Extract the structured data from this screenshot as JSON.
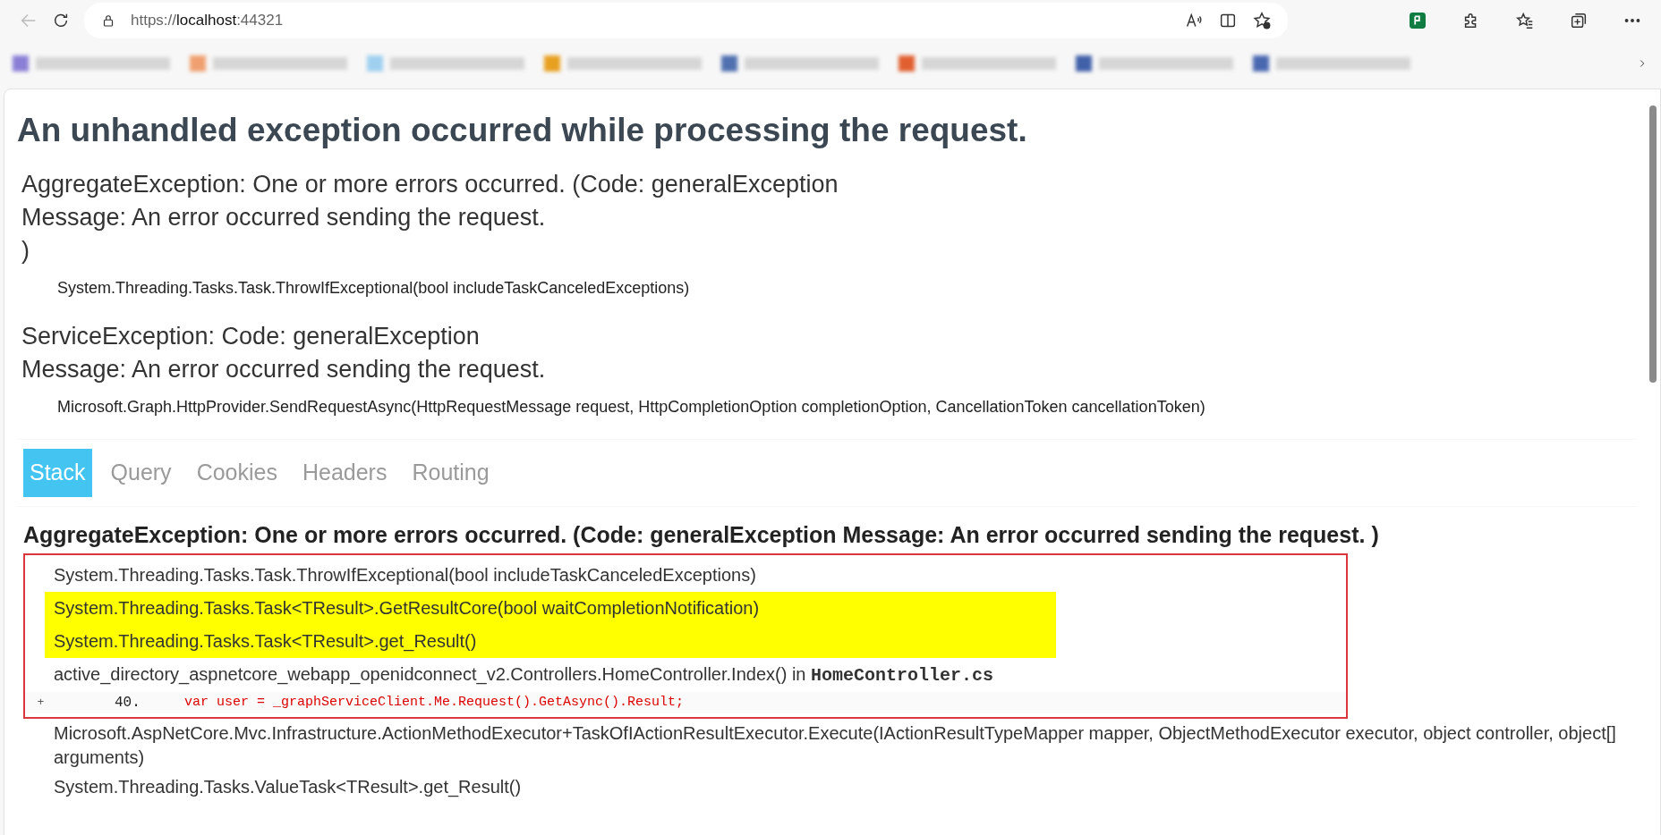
{
  "browser": {
    "url_scheme": "https://",
    "url_host": "localhost",
    "url_port": ":44321",
    "back_disabled": true
  },
  "bookmarks": [
    {
      "color": "#8a7fd6"
    },
    {
      "color": "#f0a070"
    },
    {
      "color": "#9fd0f0"
    },
    {
      "color": "#e8a020"
    },
    {
      "color": "#5070b0"
    },
    {
      "color": "#e06030"
    },
    {
      "color": "#4060a8"
    },
    {
      "color": "#4a68b0"
    }
  ],
  "page": {
    "title": "An unhandled exception occurred while processing the request.",
    "exceptions": [
      {
        "lines": [
          "AggregateException: One or more errors occurred. (Code: generalException",
          "Message: An error occurred sending the request.",
          ")"
        ],
        "frame": "System.Threading.Tasks.Task.ThrowIfExceptional(bool includeTaskCanceledExceptions)"
      },
      {
        "lines": [
          "ServiceException: Code: generalException",
          "Message: An error occurred sending the request."
        ],
        "frame": "Microsoft.Graph.HttpProvider.SendRequestAsync(HttpRequestMessage request, HttpCompletionOption completionOption, CancellationToken cancellationToken)"
      }
    ],
    "tabs": [
      {
        "label": "Stack",
        "selected": true
      },
      {
        "label": "Query",
        "selected": false
      },
      {
        "label": "Cookies",
        "selected": false
      },
      {
        "label": "Headers",
        "selected": false
      },
      {
        "label": "Routing",
        "selected": false
      }
    ],
    "stack": {
      "heading": "AggregateException: One or more errors occurred. (Code: generalException Message: An error occurred sending the request. )",
      "frames": [
        {
          "method": "System.Threading.Tasks.Task.ThrowIfExceptional(bool includeTaskCanceledExceptions)",
          "highlighted": false,
          "boxed": true
        },
        {
          "method": "System.Threading.Tasks.Task<TResult>.GetResultCore(bool waitCompletionNotification)",
          "highlighted": true,
          "boxed": true
        },
        {
          "method": "System.Threading.Tasks.Task<TResult>.get_Result()",
          "highlighted": true,
          "boxed": true
        },
        {
          "method": "active_directory_aspnetcore_webapp_openidconnect_v2.Controllers.HomeController.Index() in",
          "file": "HomeController.cs",
          "highlighted": false,
          "boxed": true,
          "code": {
            "expander": "+",
            "line": "40.",
            "text": "var user =  _graphServiceClient.Me.Request().GetAsync().Result;"
          }
        },
        {
          "method": "Microsoft.AspNetCore.Mvc.Infrastructure.ActionMethodExecutor+TaskOfIActionResultExecutor.Execute(IActionResultTypeMapper mapper, ObjectMethodExecutor executor, object controller, object[] arguments)",
          "highlighted": false,
          "boxed": false
        },
        {
          "method": "System.Threading.Tasks.ValueTask<TResult>.get_Result()",
          "highlighted": false,
          "boxed": false
        }
      ]
    }
  }
}
